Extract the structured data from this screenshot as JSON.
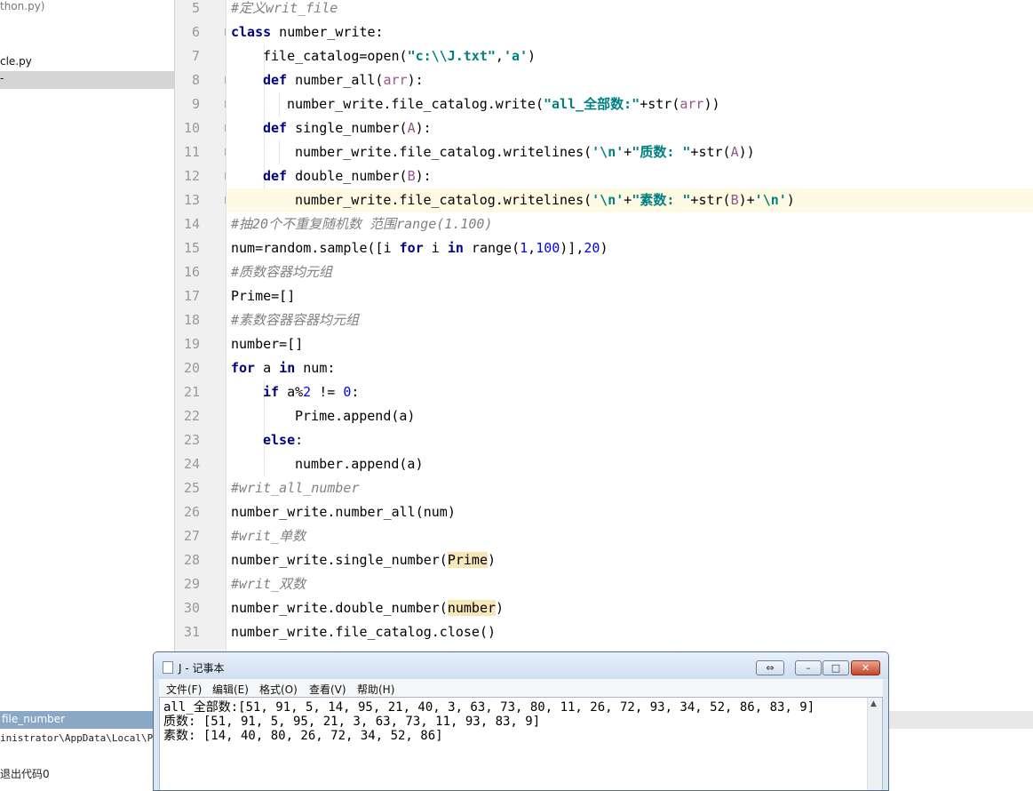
{
  "project": {
    "files": [
      "thon.py)",
      "cle.py",
      "-"
    ]
  },
  "editor": {
    "line_numbers": [
      "5",
      "6",
      "7",
      "8",
      "9",
      "10",
      "11",
      "12",
      "13",
      "14",
      "15",
      "16",
      "17",
      "18",
      "19",
      "20",
      "21",
      "22",
      "23",
      "24",
      "25",
      "26",
      "27",
      "28",
      "29",
      "30",
      "31"
    ],
    "code": {
      "l5": "#定义writ_file",
      "l6_kw": "class",
      "l6_rest": " number_write:",
      "l7_a": "file_catalog=open(",
      "l7_s1": "\"c:\\\\J.txt\"",
      "l7_b": ",",
      "l7_s2": "'a'",
      "l7_c": ")",
      "l8_kw": "def",
      "l8_a": " number_all(",
      "l8_p": "arr",
      "l8_b": "):",
      "l9_a": "number_write.file_catalog.write(",
      "l9_s": "\"all_全部数:\"",
      "l9_b": "+str(",
      "l9_p": "arr",
      "l9_c": "))",
      "l10_kw": "def",
      "l10_a": " single_number(",
      "l10_p": "A",
      "l10_b": "):",
      "l11_a": "number_write.file_catalog.writelines(",
      "l11_s1": "'\\n'",
      "l11_b": "+",
      "l11_s2": "\"质数: \"",
      "l11_c": "+str(",
      "l11_p": "A",
      "l11_d": "))",
      "l12_kw": "def",
      "l12_a": " double_number(",
      "l12_p": "B",
      "l12_b": "):",
      "l13_a": "number_write.file_catalog.writelines(",
      "l13_s1": "'\\n'",
      "l13_b": "+",
      "l13_s2": "\"素数: \"",
      "l13_c": "+str(",
      "l13_p": "B",
      "l13_d": ")+",
      "l13_s3": "'\\n'",
      "l13_e": ")",
      "l14": "#抽20个不重复随机数 范围range(1.100)",
      "l15_a": "num=random.sample([i ",
      "l15_kw1": "for",
      "l15_b": " i ",
      "l15_kw2": "in",
      "l15_c": " range(",
      "l15_n1": "1",
      "l15_d": ",",
      "l15_n2": "100",
      "l15_e": ")],",
      "l15_n3": "20",
      "l15_f": ")",
      "l16": "#质数容器均元组",
      "l17": "Prime=[]",
      "l18": "#素数容器容器均元组",
      "l19": "number=[]",
      "l20_kw1": "for",
      "l20_a": " a ",
      "l20_kw2": "in",
      "l20_b": " num:",
      "l21_kw": "if",
      "l21_a": " a%",
      "l21_n1": "2",
      "l21_b": " != ",
      "l21_n2": "0",
      "l21_c": ":",
      "l22": "Prime.append(a)",
      "l23_kw": "else",
      "l23_a": ":",
      "l24": "number.append(a)",
      "l25": "#writ_all_number",
      "l26": "number_write.number_all(num)",
      "l27": "#writ_单数",
      "l28_a": "number_write.single_number(",
      "l28_h": "Prime",
      "l28_b": ")",
      "l29": "#writ_双数",
      "l30_a": "number_write.double_number(",
      "l30_h": "number",
      "l30_b": ")",
      "l31": "number_write.file_catalog.close()"
    }
  },
  "run_panel": {
    "tab_label": "file_number",
    "path": "inistrator\\AppData\\Local\\Pro",
    "exit_text": "退出代码0"
  },
  "notepad": {
    "title": "J - 记事本",
    "menu": [
      "文件(F)",
      "编辑(E)",
      "格式(O)",
      "查看(V)",
      "帮助(H)"
    ],
    "content": [
      "all_全部数:[51, 91, 5, 14, 95, 21, 40, 3, 63, 73, 80, 11, 26, 72, 93, 34, 52, 86, 83, 9]",
      "质数: [51, 91, 5, 95, 21, 3, 63, 73, 11, 93, 83, 9]",
      "素数: [14, 40, 80, 26, 72, 34, 52, 86]"
    ],
    "restore_glyph": "⇔",
    "min_glyph": "–",
    "max_glyph": "□",
    "close_glyph": "✕",
    "scroll_glyph": "▲"
  }
}
